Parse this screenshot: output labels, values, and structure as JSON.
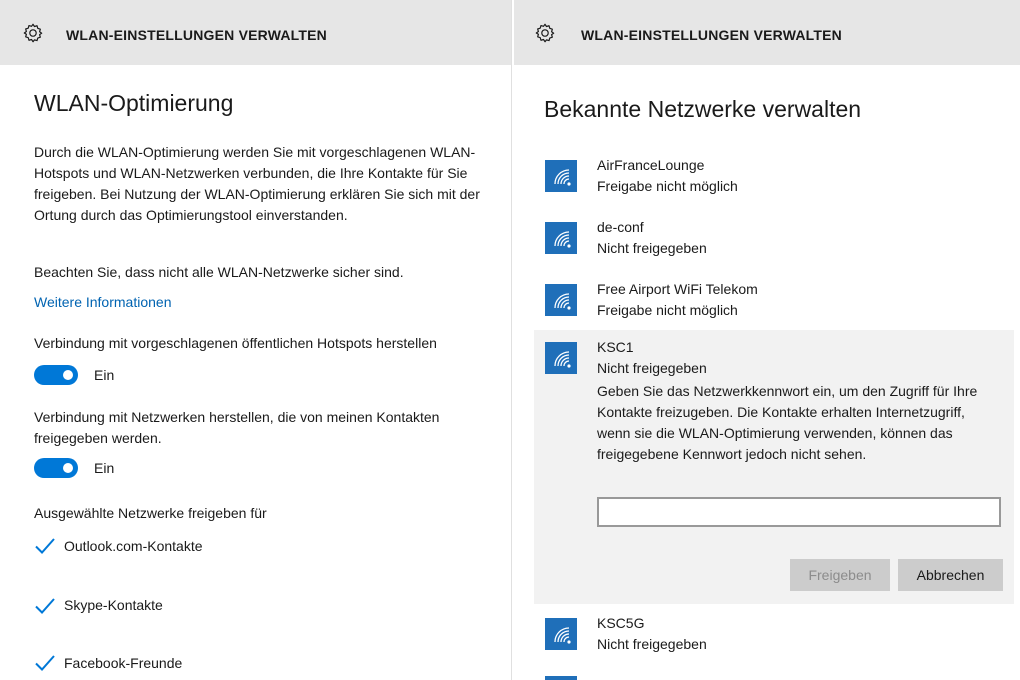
{
  "left": {
    "titlebar": {
      "title": "WLAN-EINSTELLUNGEN VERWALTEN",
      "icon": "gear-icon"
    },
    "heading": "WLAN-Optimierung",
    "description": "Durch die WLAN-Optimierung werden Sie mit vorgeschlagenen WLAN-Hotspots und WLAN-Netzwerken verbunden, die Ihre Kontakte für Sie freigeben. Bei Nutzung der WLAN-Optimierung erklären Sie sich mit der Ortung durch das Optimierungstool einverstanden.",
    "warning": "Beachten Sie, dass nicht alle WLAN-Netzwerke sicher sind.",
    "more_info_link": "Weitere Informationen",
    "hotspots_label": "Verbindung mit vorgeschlagenen öffentlichen Hotspots herstellen",
    "hotspots_toggle": {
      "state": "Ein",
      "on": true
    },
    "contacts_label": "Verbindung mit Netzwerken herstellen, die von meinen Kontakten freigegeben werden.",
    "contacts_toggle": {
      "state": "Ein",
      "on": true
    },
    "share_label": "Ausgewählte Netzwerke freigeben für",
    "share_options": [
      {
        "label": "Outlook.com-Kontakte",
        "checked": true
      },
      {
        "label": "Skype-Kontakte",
        "checked": true
      },
      {
        "label": "Facebook-Freunde",
        "checked": true
      }
    ]
  },
  "right": {
    "titlebar": {
      "title": "WLAN-EINSTELLUNGEN VERWALTEN",
      "icon": "gear-icon"
    },
    "heading": "Bekannte Netzwerke verwalten",
    "networks": [
      {
        "name": "AirFranceLounge",
        "status": "Freigabe nicht möglich"
      },
      {
        "name": "de-conf",
        "status": "Nicht freigegeben"
      },
      {
        "name": "Free Airport WiFi Telekom",
        "status": "Freigabe nicht möglich"
      },
      {
        "name": "KSC1",
        "status": "Nicht freigegeben"
      },
      {
        "name": "KSC5G",
        "status": "Nicht freigegeben"
      }
    ],
    "expanded": {
      "message": "Geben Sie das Netzwerkkennwort ein, um den Zugriff für Ihre Kontakte freizugeben. Die Kontakte erhalten Internetzugriff, wenn sie die WLAN-Optimierung verwenden, können das freigegebene Kennwort jedoch nicht sehen.",
      "password_value": "",
      "share_button": "Freigeben",
      "cancel_button": "Abbrechen"
    }
  },
  "colors": {
    "accent": "#0078d7",
    "link": "#0063b1",
    "titlebar": "#e6e6e6",
    "wifi_tile": "#1f6fb9",
    "selected_bg": "#f2f2f2"
  }
}
